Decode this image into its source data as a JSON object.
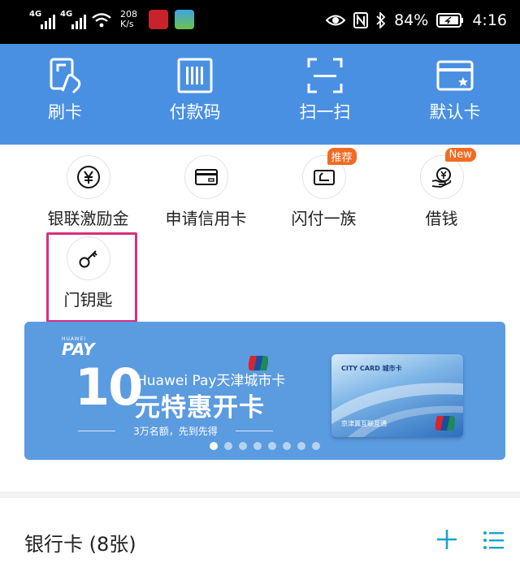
{
  "status_bar": {
    "network_left": "4G",
    "network_right": "4G",
    "speed_value": "208",
    "speed_unit": "K/s",
    "battery": "84%",
    "time": "4:16",
    "icons": [
      "eye-icon",
      "nfc-icon",
      "bluetooth-icon",
      "battery-icon"
    ]
  },
  "top_actions": [
    {
      "label": "刷卡",
      "icon": "card-tap-icon"
    },
    {
      "label": "付款码",
      "icon": "barcode-icon"
    },
    {
      "label": "扫一扫",
      "icon": "scan-icon"
    },
    {
      "label": "默认卡",
      "icon": "default-card-icon"
    }
  ],
  "services": [
    {
      "label": "银联激励金",
      "icon": "yuan-coin-icon",
      "badge": ""
    },
    {
      "label": "申请信用卡",
      "icon": "credit-card-icon",
      "badge": ""
    },
    {
      "label": "闪付一族",
      "icon": "quickpass-icon",
      "badge": "推荐"
    },
    {
      "label": "借钱",
      "icon": "loan-hand-icon",
      "badge": "New"
    },
    {
      "label": "门钥匙",
      "icon": "key-icon",
      "badge": ""
    }
  ],
  "banner": {
    "logo_small": "HUAWEI",
    "logo_pay": "PAY",
    "big_number": "10",
    "line1": "Huawei Pay天津城市卡",
    "line2": "元特惠开卡",
    "subtitle": "3万名额，先到先得",
    "card_title": "CITY CARD 城市卡",
    "card_subtitle": "京津冀互联互通",
    "page_count": 8,
    "active_page": 1
  },
  "bank_section": {
    "title": "银行卡 (8张)",
    "add_icon": "plus-icon",
    "list_icon": "list-icon"
  },
  "colors": {
    "header_blue": "#4a90e2",
    "banner_blue": "#5b9be0",
    "badge_orange": "#f26b22",
    "highlight_pink": "#d6307d",
    "accent_teal": "#1aa3c8"
  }
}
